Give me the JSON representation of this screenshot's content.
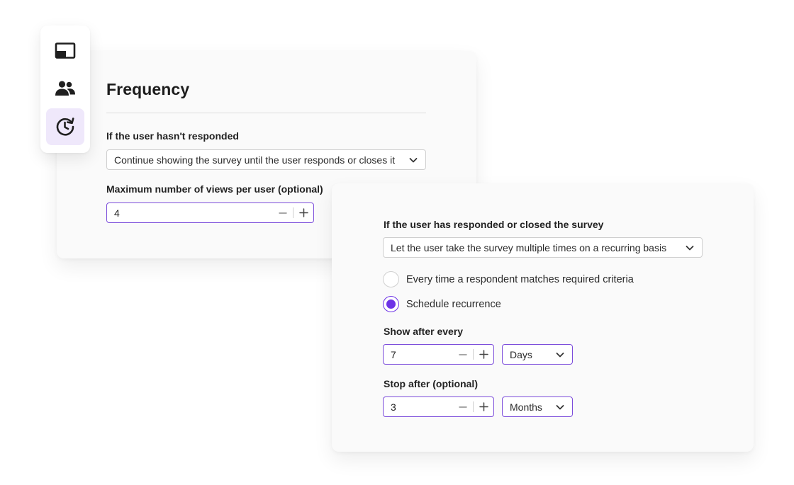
{
  "sidebar": {
    "items": [
      {
        "icon": "display-icon",
        "active": false
      },
      {
        "icon": "users-icon",
        "active": false
      },
      {
        "icon": "recurrence-icon",
        "active": true
      }
    ]
  },
  "frequency": {
    "title": "Frequency",
    "not_responded_label": "If the user hasn't responded",
    "not_responded_value": "Continue showing the survey until the user responds or closes it",
    "max_views_label": "Maximum number of views per user (optional)",
    "max_views_value": "4"
  },
  "recurrence": {
    "responded_label": "If the user has responded or closed the survey",
    "responded_value": "Let the user take the survey multiple times on a recurring basis",
    "options": [
      {
        "label": "Every time a respondent matches required criteria",
        "checked": false
      },
      {
        "label": "Schedule recurrence",
        "checked": true
      }
    ],
    "show_after_label": "Show after every",
    "show_after_value": "7",
    "show_after_unit": "Days",
    "stop_after_label": "Stop after (optional)",
    "stop_after_value": "3",
    "stop_after_unit": "Months"
  },
  "colors": {
    "accent": "#6d33e6",
    "accent_border": "#7c4ddb",
    "active_bg": "#efe8fb"
  }
}
